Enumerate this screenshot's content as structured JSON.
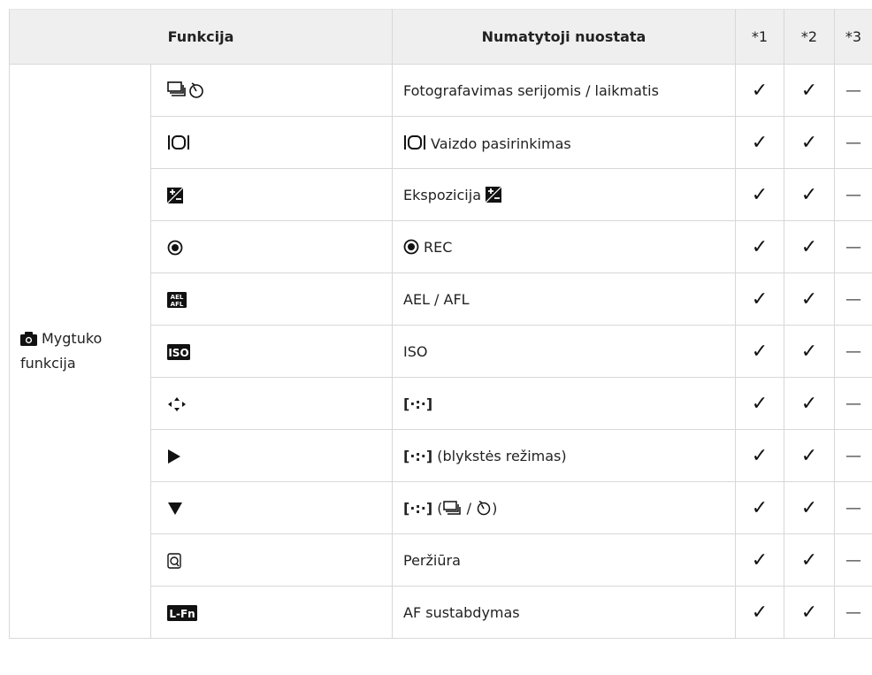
{
  "header": {
    "col_function": "Funkcija",
    "col_default": "Numatytoji nuostata",
    "col_1": "*1",
    "col_2": "*2",
    "col_3": "*3"
  },
  "category": {
    "icon": "camera-icon",
    "line1": "Mygtuko",
    "line2": "funkcija"
  },
  "rows": [
    {
      "icon": "sequential-shooting-self-timer-icon",
      "text": "Fotografavimas serijomis / laikmatis",
      "c1": "✓",
      "c2": "✓",
      "c3": "—"
    },
    {
      "icon": "image-aspect-icon",
      "prefix_icon": "image-aspect-icon",
      "text": "Vaizdo pasirinkimas",
      "c1": "✓",
      "c2": "✓",
      "c3": "—"
    },
    {
      "icon": "exposure-compensation-icon",
      "text": "Ekspozicija",
      "suffix_icon": "exposure-compensation-icon",
      "c1": "✓",
      "c2": "✓",
      "c3": "—"
    },
    {
      "icon": "record-icon",
      "prefix_icon": "record-icon",
      "text": "REC",
      "c1": "✓",
      "c2": "✓",
      "c3": "—"
    },
    {
      "icon": "ael-afl-icon",
      "text": "AEL / AFL",
      "c1": "✓",
      "c2": "✓",
      "c3": "—"
    },
    {
      "icon": "iso-icon",
      "text": "ISO",
      "c1": "✓",
      "c2": "✓",
      "c3": "—"
    },
    {
      "icon": "arrow-pad-icon",
      "text": "[·:·]",
      "c1": "✓",
      "c2": "✓",
      "c3": "—"
    },
    {
      "icon": "play-right-icon",
      "text": "[·:·]",
      "suffix": "(blykstės režimas)",
      "c1": "✓",
      "c2": "✓",
      "c3": "—"
    },
    {
      "icon": "triangle-down-icon",
      "text": "[·:·]",
      "suffix_open": "(",
      "suffix_sep": "/",
      "suffix_close": ")",
      "c1": "✓",
      "c2": "✓",
      "c3": "—"
    },
    {
      "icon": "preview-icon",
      "text": "Peržiūra",
      "c1": "✓",
      "c2": "✓",
      "c3": "—"
    },
    {
      "icon": "l-fn-icon",
      "text": "AF sustabdymas",
      "c1": "✓",
      "c2": "✓",
      "c3": "—"
    }
  ],
  "colors": {
    "header_bg": "#efefef",
    "border": "#d8d8d8"
  }
}
